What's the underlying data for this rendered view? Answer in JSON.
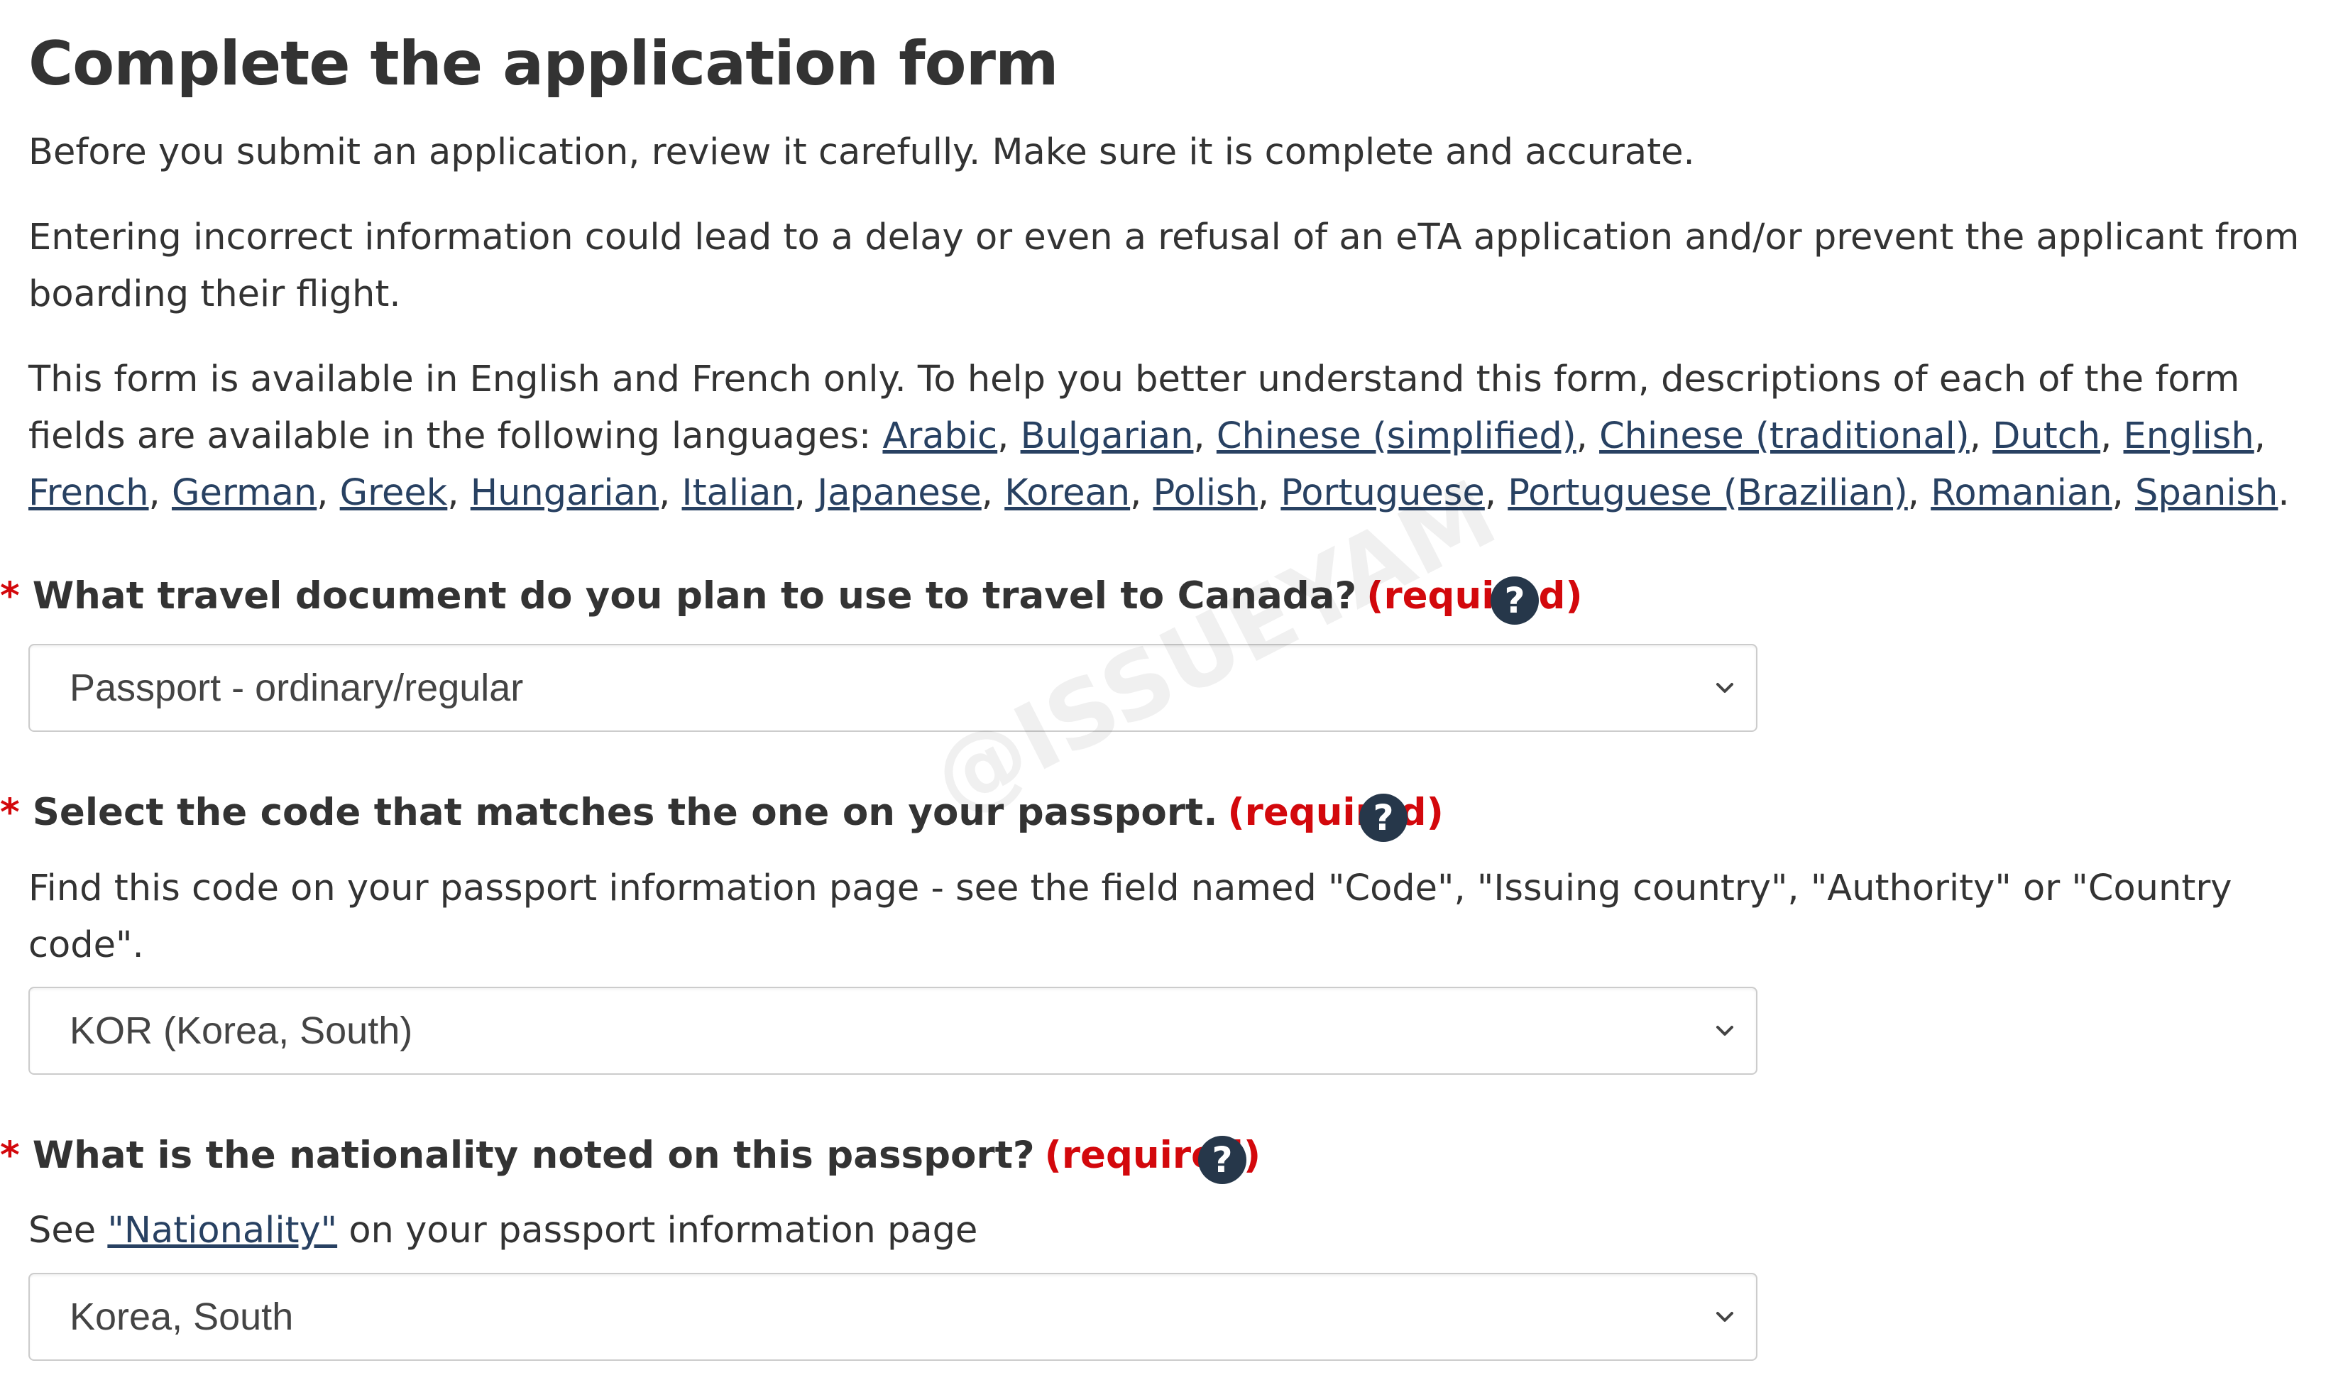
{
  "heading": "Complete the application form",
  "intro": {
    "p1": "Before you submit an application, review it carefully. Make sure it is complete and accurate.",
    "p2": "Entering incorrect information could lead to a delay or even a refusal of an eTA application and/or prevent the applicant from boarding their flight.",
    "p3_text": "This form is available in English and French only. To help you better understand this form, descriptions of each of the form fields are available in the following languages:",
    "languages": [
      "Arabic",
      "Bulgarian",
      "Chinese (simplified)",
      "Chinese (traditional)",
      "Dutch",
      "English",
      "French",
      "German",
      "Greek",
      "Hungarian",
      "Italian",
      "Japanese",
      "Korean",
      "Polish",
      "Portuguese",
      "Portuguese (Brazilian)",
      "Romanian",
      "Spanish"
    ]
  },
  "required_label": "(required)",
  "required_marker": "*",
  "questions": {
    "travel_document": {
      "label": "What travel document do you plan to use to travel to Canada?",
      "selected": "Passport - ordinary/regular"
    },
    "passport_code": {
      "label": "Select the code that matches the one on your passport.",
      "hint": "Find this code on your passport information page - see the field named \"Code\", \"Issuing country\", \"Authority\" or \"Country code\".",
      "selected": "KOR (Korea, South)"
    },
    "nationality": {
      "label": "What is the nationality noted on this passport?",
      "hint_before": "See",
      "hint_link": "\"Nationality\"",
      "hint_after": "on your passport information page",
      "selected": "Korea, South"
    }
  },
  "help_icon_glyph": "?",
  "watermark": "@ISSUEYAM",
  "colors": {
    "required": "#d3080c",
    "link": "#284162",
    "help_icon": "#26374a",
    "text": "#333333"
  }
}
